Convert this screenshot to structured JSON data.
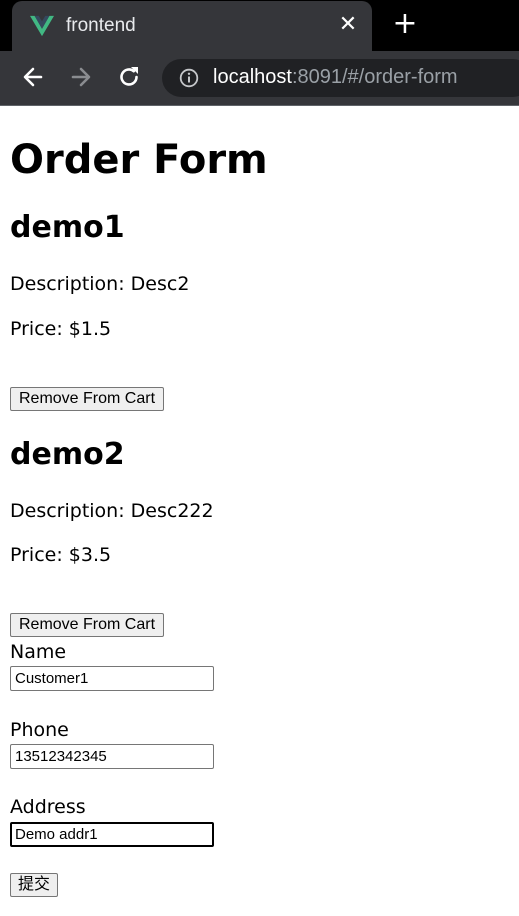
{
  "browser": {
    "tab_title": "frontend",
    "close_symbol": "✕",
    "new_tab_symbol": "+",
    "url_host": "localhost",
    "url_rest": ":8091/#/order-form",
    "icons": [
      "vue-logo-icon",
      "close-icon",
      "plus-icon",
      "back-arrow-icon",
      "forward-arrow-icon",
      "reload-icon",
      "info-icon"
    ]
  },
  "page": {
    "title": "Order Form",
    "items": [
      {
        "name": "demo1",
        "description": "Description: Desc2",
        "price": "Price: $1.5",
        "remove_label": "Remove From Cart"
      },
      {
        "name": "demo2",
        "description": "Description: Desc222",
        "price": "Price: $3.5",
        "remove_label": "Remove From Cart"
      }
    ],
    "form": {
      "name_label": "Name",
      "name_value": "Customer1",
      "phone_label": "Phone",
      "phone_value": "13512342345",
      "address_label": "Address",
      "address_value": "Demo addr1",
      "submit_label": "提交"
    }
  },
  "colors": {
    "tab_bar": "#000000",
    "toolbar": "#35363a",
    "omnibox": "#202124",
    "vue_green": "#41b883",
    "vue_dark": "#35495e"
  }
}
